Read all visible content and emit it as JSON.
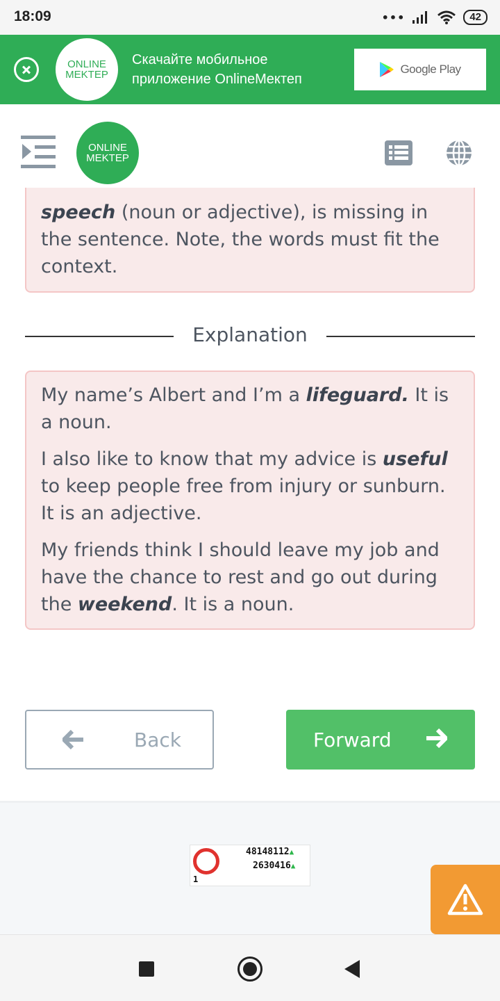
{
  "status_bar": {
    "time": "18:09",
    "signal_dots": "•••",
    "battery": "42"
  },
  "promo": {
    "logo_line1": "ONLINE",
    "logo_line2": "MEKTEP",
    "text": "Скачайте мобильное приложение OnlineMeктеп",
    "store_label": "Google Play"
  },
  "header": {
    "logo_line1": "ONLINE",
    "logo_line2": "MEKTEP"
  },
  "task": {
    "bold_term": "speech",
    "text_after": " (noun or adjective), is missing in the sentence. Note, the words must fit the context."
  },
  "explanation": {
    "heading": "Explanation",
    "p1": {
      "before": "My name’s Albert and I’m a ",
      "bold": "lifeguard.",
      "after": " It is a noun."
    },
    "p2": {
      "before": "I also like to know that my advice is ",
      "bold": "useful",
      "after": " to keep people free from injury or sunburn. It is an adjective."
    },
    "p3": {
      "before": "My friends think I should leave my job and have the chance to rest and go out during the ",
      "bold": "weekend",
      "after": ". It is a noun."
    }
  },
  "nav_buttons": {
    "back": "Back",
    "forward": "Forward"
  },
  "counter": {
    "line1": "48148112",
    "line2": "2630416",
    "rank": "1"
  },
  "colors": {
    "brand_green": "#2fad56",
    "button_green": "#52c068",
    "card_bg": "#f9eaea",
    "card_border": "#f4c6c6",
    "warning": "#f29a33"
  },
  "icons": [
    "close-icon",
    "google-play-icon",
    "menu-indent-icon",
    "list-icon",
    "globe-icon",
    "arrow-left-icon",
    "arrow-right-icon",
    "warning-icon",
    "wifi-icon",
    "signal-icon"
  ]
}
